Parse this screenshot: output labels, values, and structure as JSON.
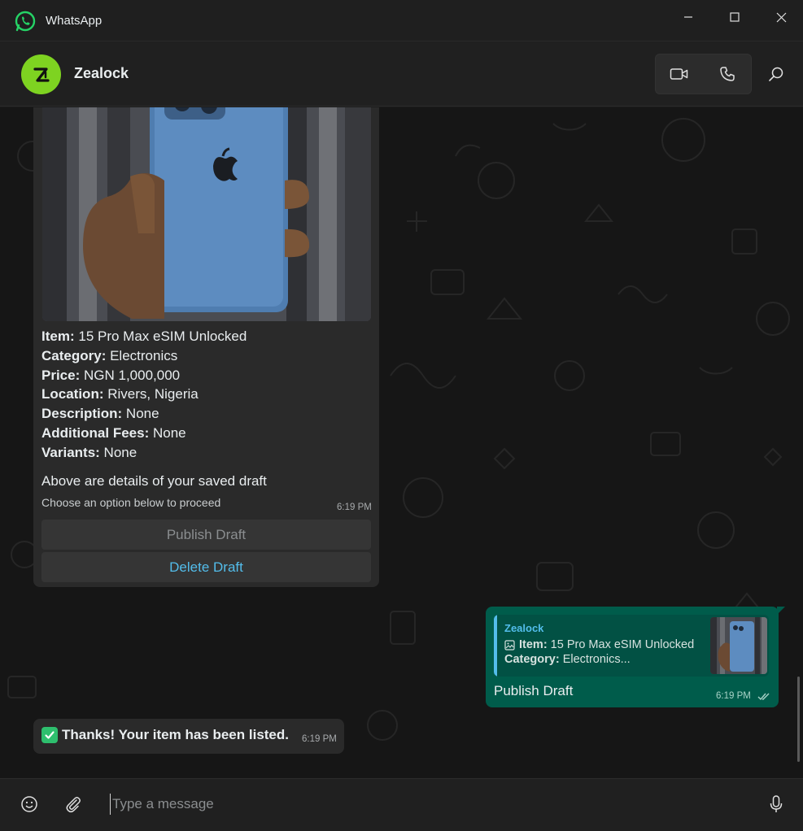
{
  "app": {
    "title": "WhatsApp"
  },
  "colors": {
    "accent": "#25D366",
    "outgoing_bubble": "#005c4b",
    "incoming_bubble": "#2a2a2a",
    "link_blue": "#53bdeb"
  },
  "header": {
    "contact_name": "Zealock",
    "avatar_icon": "zealock-logo",
    "video_icon": "video-camera-icon",
    "call_icon": "phone-icon",
    "search_icon": "search-icon"
  },
  "messages": {
    "product": {
      "details": [
        {
          "label": "Item",
          "value": " 15 Pro Max eSIM Unlocked"
        },
        {
          "label": "Category",
          "value": " Electronics"
        },
        {
          "label": "Price",
          "value": " NGN 1,000,000"
        },
        {
          "label": "Location",
          "value": " Rivers, Nigeria"
        },
        {
          "label": "Description",
          "value": " None"
        },
        {
          "label": "Additional Fees",
          "value": " None"
        },
        {
          "label": "Variants",
          "value": " None"
        }
      ],
      "note": "Above are details of your saved draft",
      "subnote": "Choose an option below to proceed",
      "time": "6:19 PM",
      "buttons": {
        "publish": "Publish Draft",
        "delete": "Delete Draft"
      }
    },
    "outgoing": {
      "quote_name": "Zealock",
      "quote_item_label": "Item:",
      "quote_item_value": " 15 Pro Max eSIM Unlocked",
      "quote_category_label": "Category:",
      "quote_category_value": " Electronics...",
      "text": "Publish Draft",
      "time": "6:19 PM"
    },
    "thanks": {
      "text": "Thanks! Your item has been listed.",
      "time": "6:19 PM"
    }
  },
  "composer": {
    "placeholder": "Type a message",
    "emoji_icon": "emoji-icon",
    "attach_icon": "paperclip-icon",
    "mic_icon": "microphone-icon"
  }
}
